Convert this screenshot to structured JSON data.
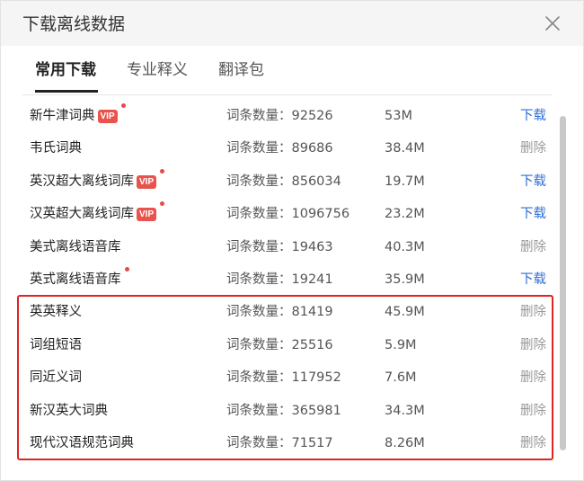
{
  "dialog": {
    "title": "下载离线数据"
  },
  "tabs": [
    {
      "label": "常用下载",
      "active": true
    },
    {
      "label": "专业释义",
      "active": false
    },
    {
      "label": "翻译包",
      "active": false
    }
  ],
  "count_label": "词条数量：",
  "rows": [
    {
      "name": "新牛津词典",
      "vip": true,
      "dot": true,
      "count": "92526",
      "size": "53M",
      "action": "下载"
    },
    {
      "name": "韦氏词典",
      "vip": false,
      "dot": false,
      "count": "89686",
      "size": "38.4M",
      "action": "删除"
    },
    {
      "name": "英汉超大离线词库",
      "vip": true,
      "dot": true,
      "count": "856034",
      "size": "19.7M",
      "action": "下载"
    },
    {
      "name": "汉英超大离线词库",
      "vip": true,
      "dot": true,
      "count": "1096756",
      "size": "23.2M",
      "action": "下载"
    },
    {
      "name": "美式离线语音库",
      "vip": false,
      "dot": false,
      "count": "19463",
      "size": "40.3M",
      "action": "删除"
    },
    {
      "name": "英式离线语音库",
      "vip": false,
      "dot": true,
      "count": "19241",
      "size": "35.9M",
      "action": "下载"
    },
    {
      "name": "英英释义",
      "vip": false,
      "dot": false,
      "count": "81419",
      "size": "45.9M",
      "action": "删除"
    },
    {
      "name": "词组短语",
      "vip": false,
      "dot": false,
      "count": "25516",
      "size": "5.9M",
      "action": "删除"
    },
    {
      "name": "同近义词",
      "vip": false,
      "dot": false,
      "count": "117952",
      "size": "7.6M",
      "action": "删除"
    },
    {
      "name": "新汉英大词典",
      "vip": false,
      "dot": false,
      "count": "365981",
      "size": "34.3M",
      "action": "删除"
    },
    {
      "name": "现代汉语规范词典",
      "vip": false,
      "dot": false,
      "count": "71517",
      "size": "8.26M",
      "action": "删除"
    }
  ],
  "vip_badge": "VIP",
  "colors": {
    "download": "#2f6fd6",
    "delete": "#999999",
    "vip": "#e8544d",
    "highlight": "#e02424"
  }
}
